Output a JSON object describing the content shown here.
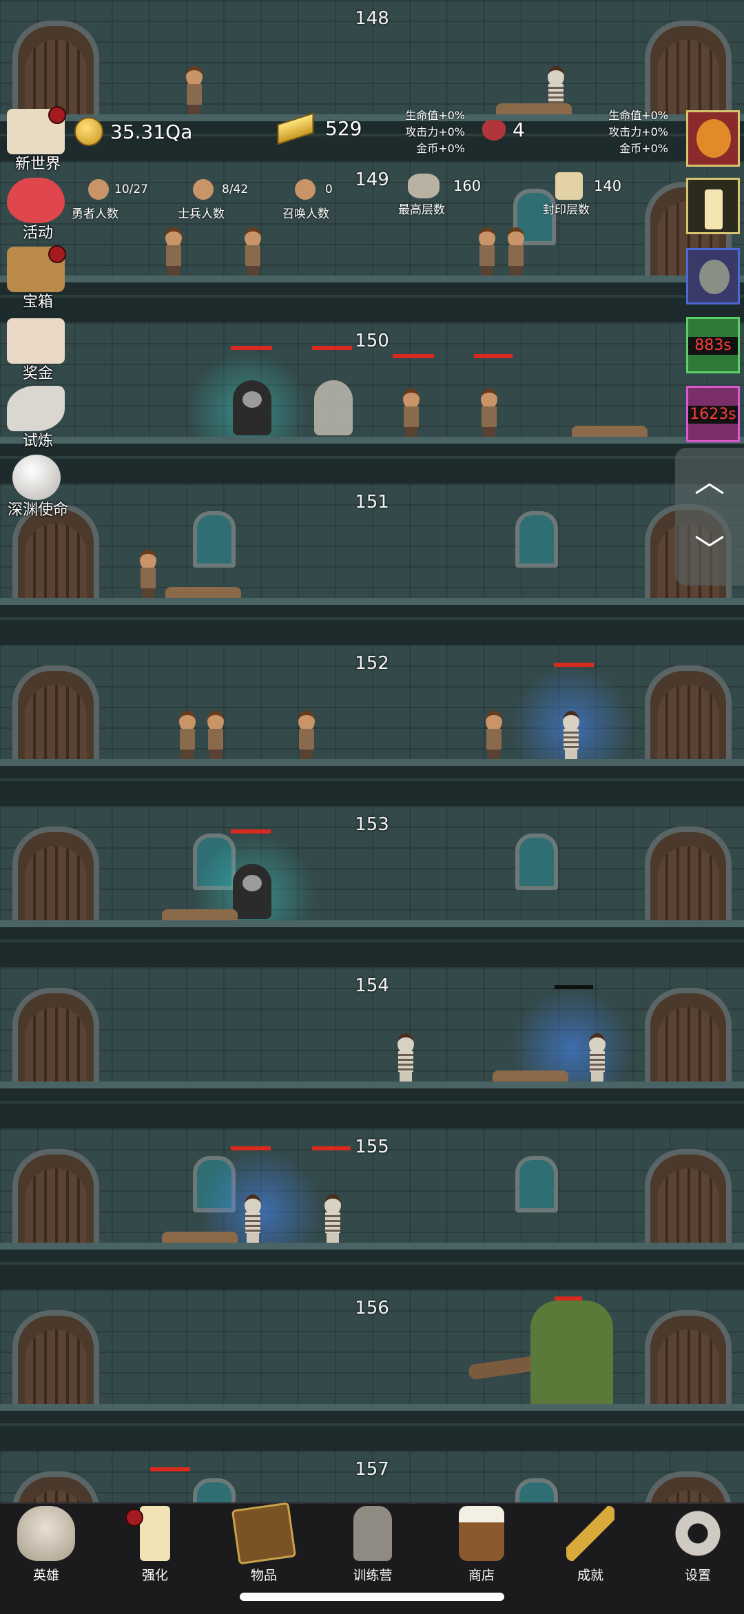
{
  "floors": [
    "148",
    "149",
    "150",
    "151",
    "152",
    "153",
    "154",
    "155",
    "156",
    "157"
  ],
  "hud": {
    "coins": "35.31Qa",
    "gold_bars": "529",
    "bonus_mid": [
      "生命值+0%",
      "攻击力+0%",
      "金币+0%"
    ],
    "gems": "4",
    "bonus_right": [
      "生命值+0%",
      "攻击力+0%",
      "金币+0%"
    ],
    "heroes_count": "10/27",
    "heroes_label": "勇者人数",
    "soldiers_count": "8/42",
    "soldiers_label": "士兵人数",
    "summon_count": "0",
    "summon_label": "召唤人数",
    "max_floor": "160",
    "max_floor_label": "最高层数",
    "sealed_floor": "140",
    "sealed_floor_label": "封印层数"
  },
  "left_menu": [
    {
      "label": "新世界",
      "icon": "map-scroll-icon",
      "dot": true
    },
    {
      "label": "活动",
      "icon": "heart-icon",
      "dot": false
    },
    {
      "label": "宝箱",
      "icon": "treasure-chest-icon",
      "dot": true
    },
    {
      "label": "奖金",
      "icon": "envelope-icon",
      "dot": false
    },
    {
      "label": "试炼",
      "icon": "feather-icon",
      "dot": false
    },
    {
      "label": "深渊使命",
      "icon": "pearl-icon",
      "dot": false
    }
  ],
  "right_menu": [
    {
      "icon": "pumpkin-icon",
      "timer": ""
    },
    {
      "icon": "candle-icon",
      "timer": ""
    },
    {
      "icon": "portrait-icon",
      "timer": ""
    },
    {
      "icon": "green-reward-icon",
      "timer": "883s"
    },
    {
      "icon": "pink-reward-icon",
      "timer": "1623s"
    }
  ],
  "bottom_tabs": [
    {
      "label": "英雄",
      "icon": "skull-icon",
      "dot": false
    },
    {
      "label": "强化",
      "icon": "candle-icon",
      "dot": true
    },
    {
      "label": "物品",
      "icon": "book-icon",
      "dot": false
    },
    {
      "label": "训练营",
      "icon": "lantern-icon",
      "dot": false
    },
    {
      "label": "商店",
      "icon": "beer-mug-icon",
      "dot": false
    },
    {
      "label": "成就",
      "icon": "key-icon",
      "dot": false
    },
    {
      "label": "设置",
      "icon": "gear-icon",
      "dot": false
    }
  ],
  "colors": {
    "hp_bar": "#d82a1f",
    "badge": "#a31a1f",
    "timer_text": "#ff3b3b"
  }
}
